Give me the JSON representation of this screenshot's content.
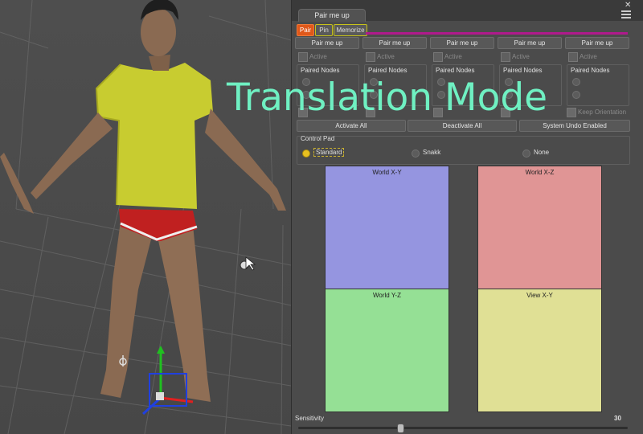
{
  "panel": {
    "title": "Pair me up",
    "close_glyph": "✕",
    "subtabs": [
      "Pair",
      "Pin",
      "Memorize"
    ],
    "pair_buttons": [
      "Pair me up",
      "Pair me up",
      "Pair me up",
      "Pair me up",
      "Pair me up"
    ],
    "active_label": "Active",
    "paired_nodes_label": "Paired Nodes",
    "keep_label": "Keep Orientation",
    "actions": {
      "activate_all": "Activate All",
      "deactivate_all": "Deactivate All",
      "system_undo": "System Undo Enabled"
    },
    "control_pad": {
      "label": "Control Pad",
      "options": [
        "Standard",
        "Snakk",
        "None"
      ],
      "selected": "Standard"
    },
    "pads": [
      {
        "label": "World X-Y",
        "color": "#9595e0"
      },
      {
        "label": "World X-Z",
        "color": "#e09595"
      },
      {
        "label": "World Y-Z",
        "color": "#95e095"
      },
      {
        "label": "View X-Y",
        "color": "#e0e095"
      }
    ],
    "sensitivity": {
      "label": "Sensitivity",
      "value": "30",
      "fraction": 0.31
    }
  },
  "overlay": {
    "text": "Translation Mode"
  },
  "icons": {
    "cursor": "cursor-icon",
    "gizmo": "translate-gizmo-icon"
  }
}
